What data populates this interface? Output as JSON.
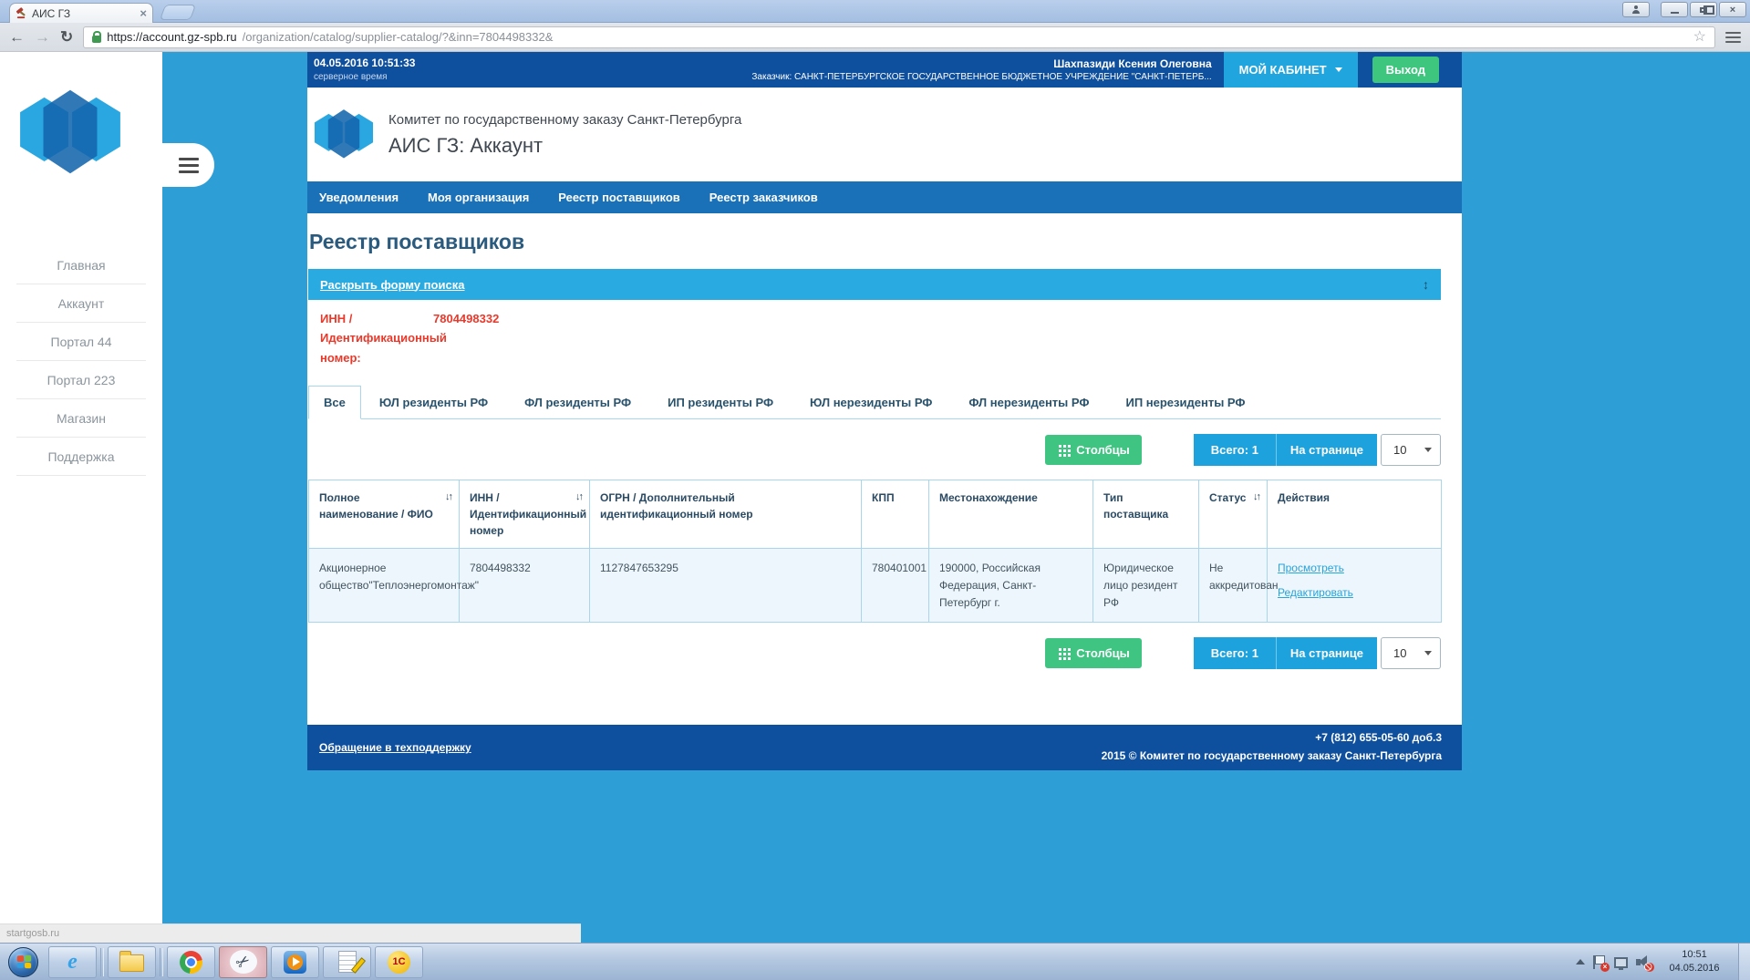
{
  "browser": {
    "tab_title": "АИС ГЗ",
    "url_host": "https://account.gz-spb.ru",
    "url_path": "/organization/catalog/supplier-catalog/?&inn=7804498332&",
    "status_text": "startgosb.ru"
  },
  "icons": {
    "back": "←",
    "forward": "→",
    "reload": "↻",
    "star": "☆",
    "tab_close": "×",
    "close": "×",
    "sort": "↓↑",
    "updown": "↕",
    "scissors": "✂",
    "ie": "e",
    "onec": "1С"
  },
  "topbar": {
    "datetime": "04.05.2016 10:51:33",
    "server_time_label": "серверное время",
    "user_name": "Шахпазиди Ксения Олеговна",
    "customer_line": "Заказчик: САНКТ-ПЕТЕРБУРГСКОЕ ГОСУДАРСТВЕННОЕ БЮДЖЕТНОЕ УЧРЕЖДЕНИЕ \"САНКТ-ПЕТЕРБ...",
    "cabinet_button": "МОЙ КАБИНЕТ",
    "logout_button": "Выход"
  },
  "header": {
    "org_name": "Комитет по государственному заказу Санкт-Петербурга",
    "app_name": "АИС ГЗ: Аккаунт"
  },
  "nav": {
    "items": [
      "Уведомления",
      "Моя организация",
      "Реестр поставщиков",
      "Реестр заказчиков"
    ]
  },
  "sidebar": {
    "items": [
      "Главная",
      "Аккаунт",
      "Портал 44",
      "Портал 223",
      "Магазин",
      "Поддержка"
    ]
  },
  "main": {
    "page_title": "Реестр поставщиков",
    "search_toggle_label": "Раскрыть форму поиска",
    "filter_label": "ИНН / Идентификационный номер:",
    "filter_value": "7804498332",
    "tabs": [
      "Все",
      "ЮЛ резиденты РФ",
      "ФЛ резиденты РФ",
      "ИП резиденты РФ",
      "ЮЛ нерезиденты РФ",
      "ФЛ нерезиденты РФ",
      "ИП нерезиденты РФ"
    ],
    "controls": {
      "columns_button": "Столбцы",
      "total_label": "Всего: 1",
      "per_page_label": "На странице",
      "per_page_value": "10"
    },
    "table": {
      "headers": [
        {
          "label": "Полное наименование / ФИО"
        },
        {
          "label": "ИНН / Идентификационный номер"
        },
        {
          "label": "ОГРН / Дополнительный идентификационный номер"
        },
        {
          "label": "КПП"
        },
        {
          "label": "Местонахождение"
        },
        {
          "label": "Тип поставщика"
        },
        {
          "label": "Статус"
        },
        {
          "label": "Действия"
        }
      ],
      "row": {
        "name": "Акционерное общество\"Теплоэнергомонтаж\"",
        "inn": "7804498332",
        "ogrn": "1127847653295",
        "kpp": "780401001",
        "location": "190000, Российская Федерация, Санкт-Петербург г.",
        "type": "Юридическое лицо резидент РФ",
        "status": "Не аккредитован",
        "action_view": "Просмотреть",
        "action_edit": "Редактировать"
      }
    }
  },
  "footer": {
    "support_link": "Обращение в техподдержку",
    "phone": "+7 (812) 655-05-60 доб.3",
    "copyright": "2015 © Комитет по государственному заказу Санкт-Петербурга"
  },
  "taskbar": {
    "clock_time": "10:51",
    "clock_date": "04.05.2016"
  },
  "colors": {
    "dark_blue": "#0e4f9e",
    "nav_blue": "#1a71b8",
    "cyan": "#29abe2",
    "accent_blue": "#1da2dd",
    "green": "#3fc482",
    "red": "#e8392b"
  }
}
